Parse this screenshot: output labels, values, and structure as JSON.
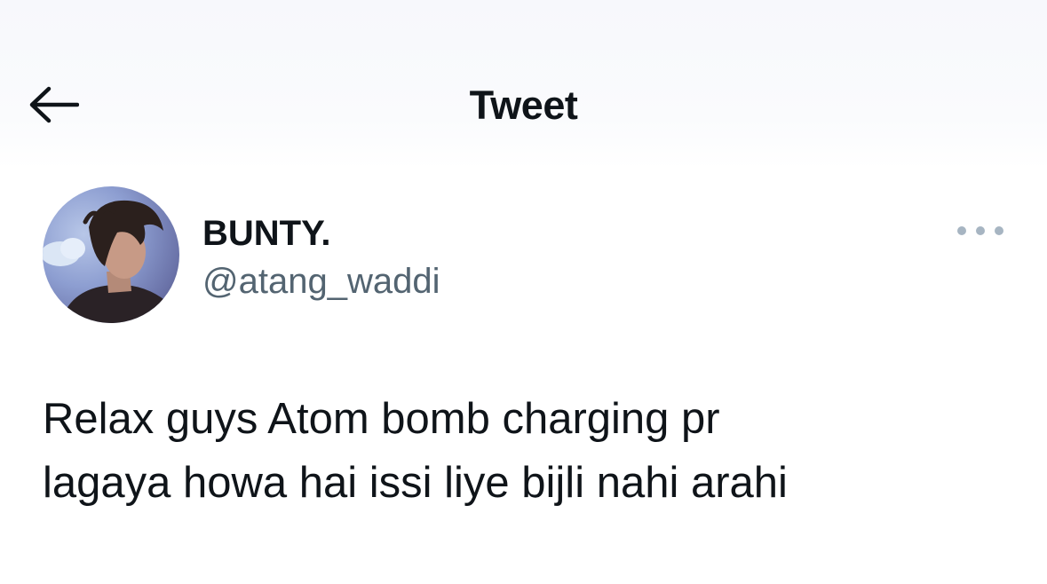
{
  "header": {
    "title": "Tweet",
    "back_icon": "arrow-left-icon"
  },
  "author": {
    "display_name": "BUNTY.",
    "handle": "@atang_waddi",
    "avatar": "profile-photo"
  },
  "menu": {
    "icon": "more-horizontal-icon"
  },
  "tweet": {
    "text": "Relax guys Atom bomb charging pr\nlagaya howa hai issi liye bijli nahi arahi"
  },
  "colors": {
    "text_primary": "#0f1419",
    "text_secondary": "#536471",
    "more_dots": "#a7b5c2"
  }
}
